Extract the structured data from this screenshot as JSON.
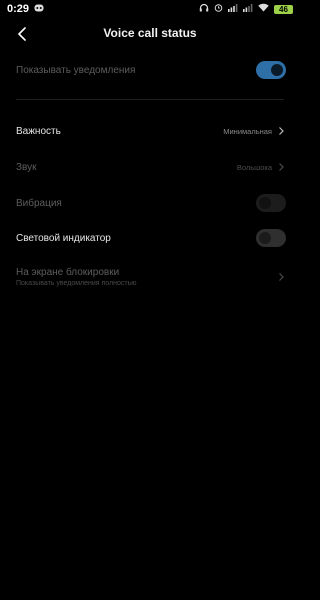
{
  "status_bar": {
    "time": "0:29",
    "battery": "46"
  },
  "header": {
    "title": "Voice call status"
  },
  "settings": {
    "show_notifications": {
      "label": "Показывать уведомления",
      "enabled": true
    },
    "importance": {
      "label": "Важность",
      "value": "Минимальная"
    },
    "sound": {
      "label": "Звук",
      "value": "Вольшока"
    },
    "vibration": {
      "label": "Вибрация",
      "enabled": false
    },
    "light_indicator": {
      "label": "Световой индикатор",
      "enabled": false
    },
    "lock_screen": {
      "label": "На экране блокировки",
      "sublabel": "Показывать уведомления полностью"
    }
  },
  "colors": {
    "accent": "#2e6fa8",
    "background": "#000000"
  }
}
